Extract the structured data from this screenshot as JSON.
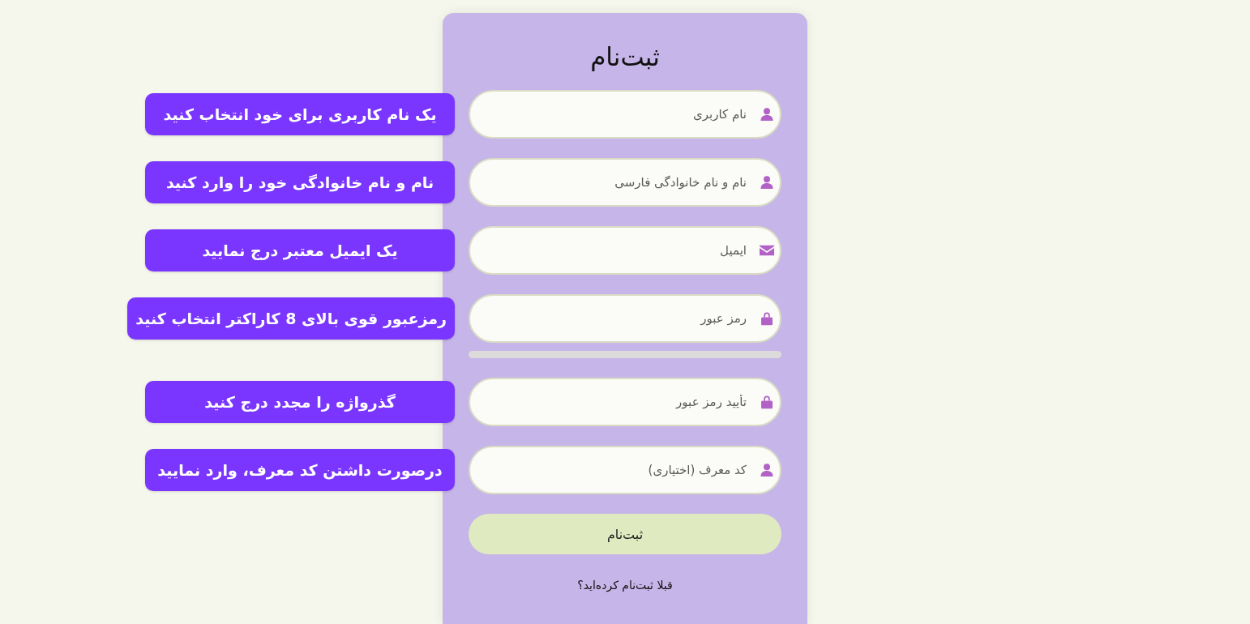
{
  "form": {
    "title": "ثبت‌نام",
    "fields": [
      {
        "kind": "text",
        "placeholder": "نام کاربری",
        "annotation": "یک نام کاربری برای خود انتخاب کنید"
      },
      {
        "kind": "text",
        "placeholder": "نام و نام خانوادگی فارسی",
        "annotation": "نام و نام خانوادگی خود را وارد کنید"
      },
      {
        "kind": "email",
        "placeholder": "ایمیل",
        "annotation": "یک ایمیل معتبر درج نمایید"
      },
      {
        "kind": "password",
        "placeholder": "رمز عبور",
        "strength_meter": true,
        "annotation": "رمزعبور قوی بالای 8 کاراکتر انتخاب کنید"
      },
      {
        "kind": "password",
        "placeholder": "تأیید رمز عبور",
        "annotation": "گذرواژه را مجدد درج کنید"
      },
      {
        "kind": "text",
        "placeholder": "کد معرف (اختیاری)",
        "annotation": "درصورت داشتن کد معرف، وارد نمایید"
      }
    ],
    "submit_button": "ثبت‌نام",
    "login_prompt": "قبلا ثبت‌نام کرده‌اید؟"
  }
}
